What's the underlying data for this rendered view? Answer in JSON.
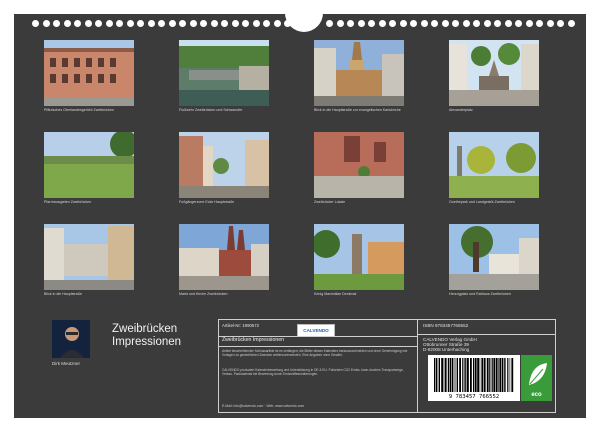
{
  "calendar": {
    "title_line1": "Zweibrücken",
    "title_line2": "Impressionen",
    "author": "Dirk Meutzner",
    "photos": [
      {
        "caption": "Pfälzisches Oberlandesgericht Zweibrücken"
      },
      {
        "caption": "Flußwehr Zweibrücken und Schwanufer"
      },
      {
        "caption": "Blick in die Hauptstraße zur evangelischen Karlskirche"
      },
      {
        "caption": "Alexanderplatz"
      },
      {
        "caption": "Pfarrhausgarten Zweibrücken"
      },
      {
        "caption": "Fußgängerzone Ecke Hauptstraße"
      },
      {
        "caption": "Zweibrücker Lokale"
      },
      {
        "caption": "Goethepark und Landgestüt Zweibrücken"
      },
      {
        "caption": "Blick in die Hauptstraße"
      },
      {
        "caption": "Markt und Kirche Zweibrücken"
      },
      {
        "caption": "König Maximilian Denkmal"
      },
      {
        "caption": "Herzogplatz und Rathaus Zweibrücken"
      }
    ]
  },
  "info": {
    "article": "Artikel-Nr: 1990572",
    "calvendo_label": "CALVENDO",
    "product_title": "Zweibrücken Impressionen",
    "desc1": "Artikel beschreibender Schlussartikel ist es verlängert, die Bilder dieses Kalenders herauszuschneiden und ohne Genehmigung wie Vorlagen zu gewerblichen Zwecken weiterzuverwenden. Eine Angaben ohne Gewähr.",
    "desc2": "CALVENDO produziert Kalenderbewertung und Unterstützung in DE & EU. Pollurisen CO2 Emiss. kann durchen Transportwege, Verkau. Packmaterial bei Bewertung durch Emisshilfesmutterungen.",
    "email": "E-Mail: info@calvendo.com · Web: www.calvendo.com",
    "isbn": "ISBN 9783457766552",
    "publisher1": "CALVENDO Verlag GmbH",
    "publisher2": "Ottobrunner Straße 39",
    "publisher3": "D-82008 Unterhaching",
    "barcode_number": "9 783457 766552",
    "eco_label": "eco"
  }
}
